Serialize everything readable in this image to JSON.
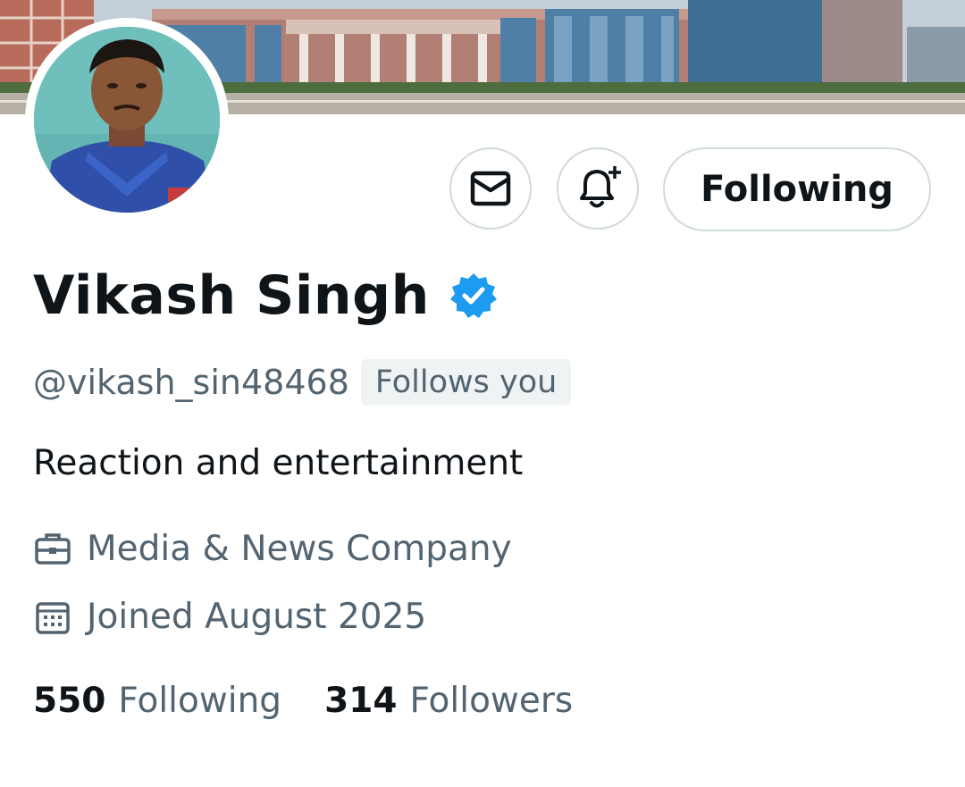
{
  "profile": {
    "name": "Vikash Singh",
    "handle": "@vikash_sin48468",
    "follows_you": "Follows you",
    "bio": "Reaction and entertainment",
    "category": "Media & News Company",
    "joined": "Joined August 2025",
    "following_count": "550",
    "following_label": "Following",
    "followers_count": "314",
    "followers_label": "Followers"
  },
  "actions": {
    "follow_state_label": "Following",
    "message_icon": "envelope-icon",
    "notify_icon": "bell-plus-icon"
  },
  "icons": {
    "verified": "verified-badge-icon",
    "category": "briefcase-icon",
    "joined": "calendar-icon"
  },
  "colors": {
    "verified_blue": "#1d9bf0",
    "text_primary": "#0f1419",
    "text_secondary": "#536471",
    "border": "#cfd9de",
    "chip_bg": "#eff3f4"
  }
}
